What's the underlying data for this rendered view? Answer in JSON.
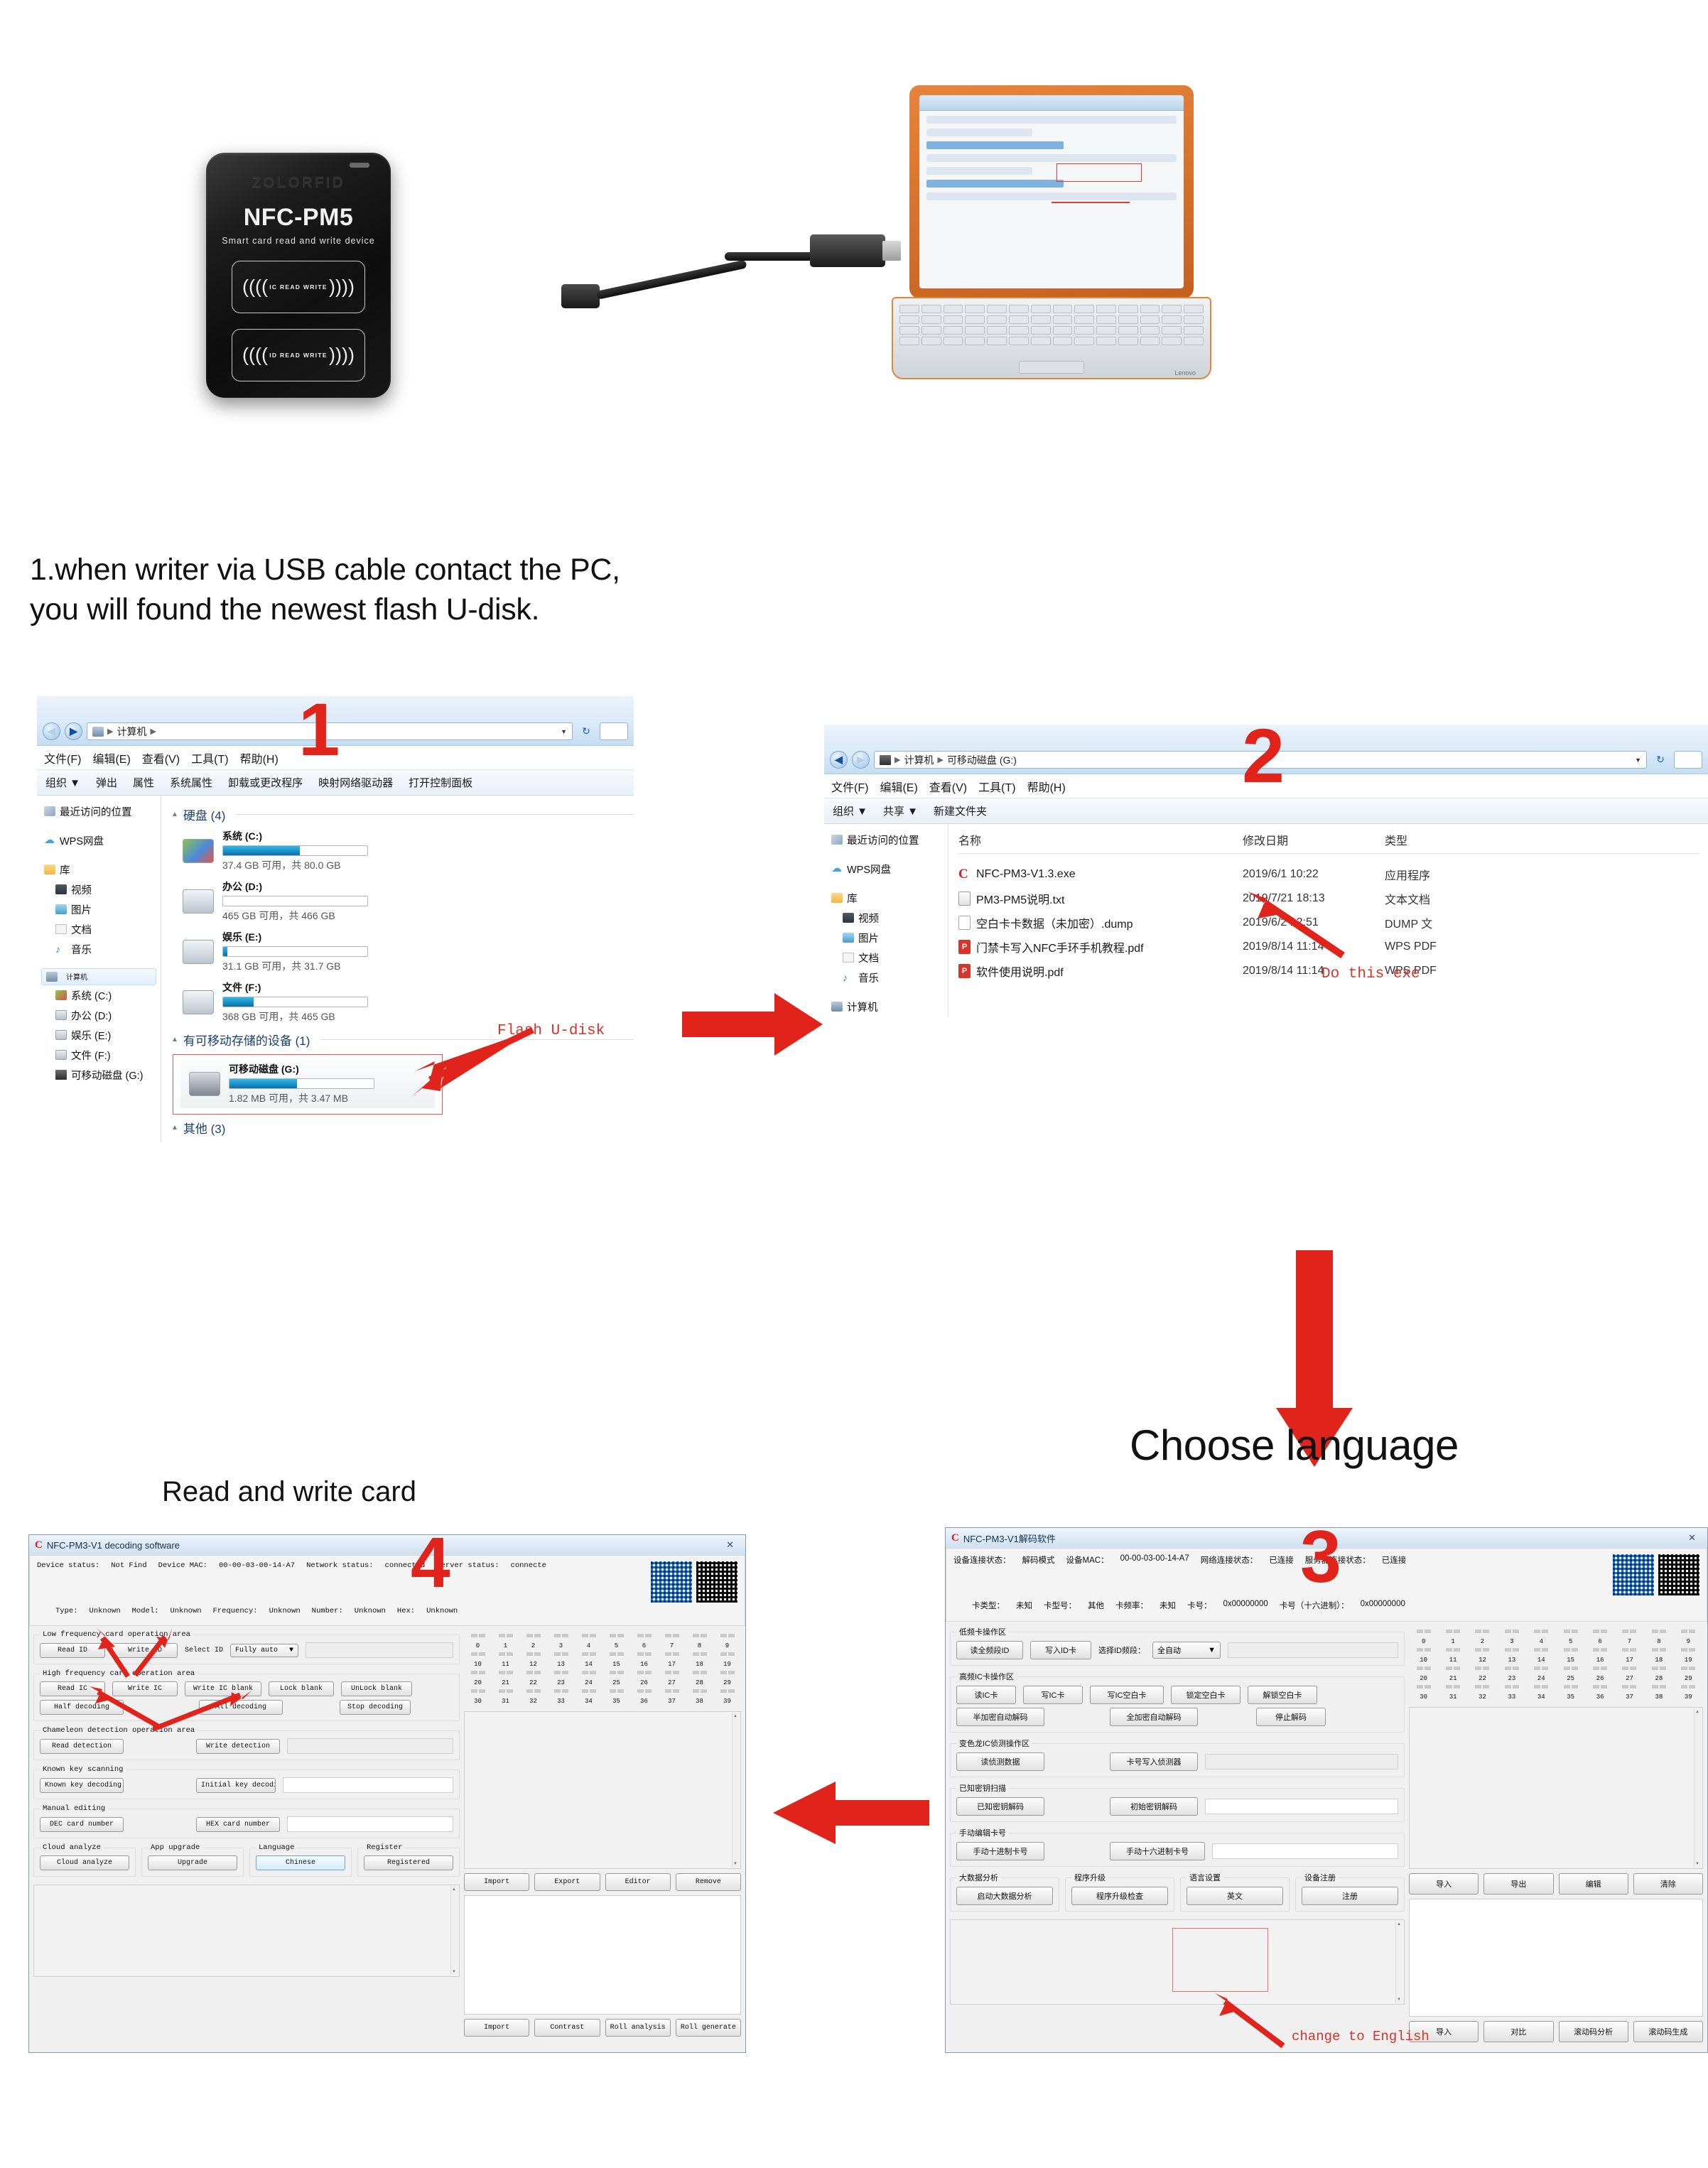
{
  "hero": {
    "device": {
      "brand": "ZOLORFID",
      "model": "NFC-PM5",
      "subtitle": "Smart  card  read  and  write  device",
      "pad_ic_label": "IC READ WRITE",
      "pad_id_label": "ID READ WRITE"
    },
    "laptop_brand": "Lenovo"
  },
  "caption": {
    "line1": "1.when writer via USB cable contact the PC,",
    "line2": "you will found the newest flash U-disk."
  },
  "headings": {
    "choose_language": "Choose language",
    "read_and_write_card": "Read and write card"
  },
  "steps": {
    "one": "1",
    "two": "2",
    "three": "3",
    "four": "4"
  },
  "annotations": {
    "flash_udisk": "Flash U-disk",
    "do_this_exe": "Do this exe",
    "change_to_english": "change to English"
  },
  "explorer1": {
    "breadcrumb": [
      "计算机"
    ],
    "menu": [
      "文件(F)",
      "编辑(E)",
      "查看(V)",
      "工具(T)",
      "帮助(H)"
    ],
    "toolbar": [
      "组织 ▼",
      "弹出",
      "属性",
      "系统属性",
      "卸载或更改程序",
      "映射网络驱动器",
      "打开控制面板"
    ],
    "nav": [
      {
        "label": "最近访问的位置",
        "icon": "recent-places-icon",
        "indent": false
      },
      {
        "label": "WPS网盘",
        "icon": "cloud-icon",
        "indent": false
      },
      {
        "label": "库",
        "icon": "folder-icon",
        "indent": false
      },
      {
        "label": "视频",
        "icon": "video-icon",
        "indent": true
      },
      {
        "label": "图片",
        "icon": "picture-icon",
        "indent": true
      },
      {
        "label": "文档",
        "icon": "document-icon",
        "indent": true
      },
      {
        "label": "音乐",
        "icon": "music-icon",
        "indent": true
      },
      {
        "label": "计算机",
        "icon": "computer-icon",
        "indent": false,
        "selected": true
      },
      {
        "label": "系统 (C:)",
        "icon": "system-drive-icon",
        "indent": true
      },
      {
        "label": "办公 (D:)",
        "icon": "drive-icon",
        "indent": true
      },
      {
        "label": "娱乐 (E:)",
        "icon": "drive-icon",
        "indent": true
      },
      {
        "label": "文件 (F:)",
        "icon": "drive-icon",
        "indent": true
      },
      {
        "label": "可移动磁盘 (G:)",
        "icon": "usb-drive-icon",
        "indent": true
      }
    ],
    "group_hdd": "硬盘 (4)",
    "group_removable": "有可移动存储的设备 (1)",
    "group_other": "其他 (3)",
    "drives": [
      {
        "name": "系统 (C:)",
        "free": "37.4 GB 可用，共 80.0 GB",
        "fill": 53,
        "icon": "system-drive-icon"
      },
      {
        "name": "办公 (D:)",
        "free": "465 GB 可用，共 466 GB",
        "fill": 0,
        "icon": "drive-icon"
      },
      {
        "name": "娱乐 (E:)",
        "free": "31.1 GB 可用，共 31.7 GB",
        "fill": 3,
        "icon": "drive-icon"
      },
      {
        "name": "文件 (F:)",
        "free": "368 GB 可用，共 465 GB",
        "fill": 21,
        "icon": "drive-icon"
      }
    ],
    "removable": {
      "name": "可移动磁盘 (G:)",
      "free": "1.82 MB 可用，共 3.47 MB",
      "fill": 47,
      "icon": "usb-drive-icon"
    }
  },
  "explorer2": {
    "breadcrumb": [
      "计算机",
      "可移动磁盘 (G:)"
    ],
    "menu": [
      "文件(F)",
      "编辑(E)",
      "查看(V)",
      "工具(T)",
      "帮助(H)"
    ],
    "toolbar": [
      "组织 ▼",
      "共享 ▼",
      "新建文件夹"
    ],
    "nav": [
      {
        "label": "最近访问的位置",
        "icon": "recent-places-icon",
        "indent": false
      },
      {
        "label": "WPS网盘",
        "icon": "cloud-icon",
        "indent": false
      },
      {
        "label": "库",
        "icon": "folder-icon",
        "indent": false
      },
      {
        "label": "视频",
        "icon": "video-icon",
        "indent": true
      },
      {
        "label": "图片",
        "icon": "picture-icon",
        "indent": true
      },
      {
        "label": "文档",
        "icon": "document-icon",
        "indent": true
      },
      {
        "label": "音乐",
        "icon": "music-icon",
        "indent": true
      },
      {
        "label": "计算机",
        "icon": "computer-icon",
        "indent": false
      }
    ],
    "columns": [
      "名称",
      "修改日期",
      "类型"
    ],
    "files": [
      {
        "name": "NFC-PM3-V1.3.exe",
        "date": "2019/6/1 10:22",
        "type": "应用程序",
        "icon": "exe-icon"
      },
      {
        "name": "PM3-PM5说明.txt",
        "date": "2019/7/21 18:13",
        "type": "文本文档",
        "icon": "txt-icon"
      },
      {
        "name": "空白卡卡数据（未加密）.dump",
        "date": "2019/6/2 12:51",
        "type": "DUMP 文",
        "icon": "dump-icon"
      },
      {
        "name": "门禁卡写入NFC手环手机教程.pdf",
        "date": "2019/8/14 11:14",
        "type": "WPS PDF",
        "icon": "pdf-icon"
      },
      {
        "name": "软件使用说明.pdf",
        "date": "2019/8/14 11:14",
        "type": "WPS PDF",
        "icon": "pdf-icon"
      }
    ]
  },
  "app_en": {
    "title": "NFC-PM3-V1 decoding software",
    "status": {
      "device_status_label": "Device status:",
      "device_status_value": "Not Find",
      "device_mac_label": "Device MAC:",
      "device_mac_value": "00-00-03-00-14-A7",
      "network_label": "Network status:",
      "network_value": "connected",
      "server_label": "Server status:",
      "server_value": "connecte",
      "type_label": "Type:",
      "type_value": "Unknown",
      "model_label": "Model:",
      "model_value": "Unknown",
      "frequency_label": "Frequency:",
      "frequency_value": "Unknown",
      "number_label": "Number:",
      "number_value": "Unknown",
      "hex_label": "Hex:",
      "hex_value": "Unknown"
    },
    "groups": {
      "low_freq": "Low frequency card operation area",
      "high_freq": "High frequency card operation area",
      "chameleon": "Chameleon detection operation area",
      "known_key": "Known key scanning",
      "manual_edit": "Manual editing",
      "cloud": "Cloud analyze",
      "app_upgrade": "App upgrade",
      "language": "Language",
      "register": "Register"
    },
    "buttons": {
      "read_id": "Read ID",
      "write_id": "Write ID",
      "select_id_label": "Select ID",
      "select_id_value": "Fully auto",
      "read_ic": "Read IC",
      "write_ic": "Write IC",
      "write_ic_blank": "Write IC blank",
      "lock_blank": "Lock blank",
      "unlock_blank": "UnLock blank",
      "half_decoding": "Half decoding",
      "all_decoding": "All decoding",
      "stop_decoding": "Stop decoding",
      "read_detection": "Read detection",
      "write_detection": "Write detection",
      "known_key_decoding": "Known key decoding",
      "initial_key_decoding": "Initial key decoding",
      "dec_card_number": "DEC card number",
      "hex_card_number": "HEX card number",
      "cloud_analyze": "Cloud analyze",
      "upgrade": "Upgrade",
      "chinese": "Chinese",
      "registered": "Registered",
      "import": "Import",
      "export": "Export",
      "editor": "Editor",
      "remove": "Remove",
      "import2": "Import",
      "contrast": "Contrast",
      "roll_analysis": "Roll analysis",
      "roll_generate": "Roll generate"
    },
    "hex_labels": [
      "0",
      "1",
      "2",
      "3",
      "4",
      "5",
      "6",
      "7",
      "8",
      "9",
      "10",
      "11",
      "12",
      "13",
      "14",
      "15",
      "16",
      "17",
      "18",
      "19",
      "20",
      "21",
      "22",
      "23",
      "24",
      "25",
      "26",
      "27",
      "28",
      "29",
      "30",
      "31",
      "32",
      "33",
      "34",
      "35",
      "36",
      "37",
      "38",
      "39"
    ]
  },
  "app_cn": {
    "title": "NFC-PM3-V1解码软件",
    "status": {
      "device_status_label": "设备连接状态：",
      "device_status_value": "解码模式",
      "device_mac_label": "设备MAC：",
      "device_mac_value": "00-00-03-00-14-A7",
      "network_label": "网络连接状态：",
      "network_value": "已连接",
      "server_label": "服务器连接状态：",
      "server_value": "已连接",
      "card_type_label": "卡类型：",
      "card_type_value": "未知",
      "card_model_label": "卡型号：",
      "card_model_value": "其他",
      "card_freq_label": "卡频率：",
      "card_freq_value": "未知",
      "card_no_label": "卡号：",
      "card_no_value": "0x00000000",
      "card_hex_label": "卡号（十六进制）：",
      "card_hex_value": "0x00000000"
    },
    "groups": {
      "low_freq": "低频卡操作区",
      "high_freq": "高频IC卡操作区",
      "chameleon": "变色龙IC侦测操作区",
      "known_key": "已知密钥扫描",
      "manual_edit": "手动编辑卡号",
      "bigdata": "大数据分析",
      "upgrade": "程序升级",
      "language": "语言设置",
      "register": "设备注册"
    },
    "buttons": {
      "read_id": "读全频段ID",
      "write_id": "写入ID卡",
      "select_id_label": "选择ID频段：",
      "select_id_value": "全自动",
      "read_ic": "读IC卡",
      "write_ic": "写IC卡",
      "write_ic_blank": "写IC空白卡",
      "lock_blank": "锁定空白卡",
      "unlock_blank": "解锁空白卡",
      "half_decoding": "半加密自动解码",
      "all_decoding": "全加密自动解码",
      "stop_decoding": "停止解码",
      "read_detection": "读侦测数据",
      "write_detection": "卡号写入侦测器",
      "known_key_decoding": "已知密钥解码",
      "initial_key_decoding": "初始密钥解码",
      "dec_card_number": "手动十进制卡号",
      "hex_card_number": "手动十六进制卡号",
      "bigdata_start": "启动大数据分析",
      "upgrade_check": "程序升级检查",
      "english": "英文",
      "register": "注册",
      "import": "导入",
      "export": "导出",
      "edit": "编辑",
      "clear": "清除",
      "import2": "导入",
      "contrast": "对比",
      "roll_analysis": "滚动码分析",
      "roll_generate": "滚动码生成"
    },
    "hex_labels": [
      "0",
      "1",
      "2",
      "3",
      "4",
      "5",
      "6",
      "7",
      "8",
      "9",
      "10",
      "11",
      "12",
      "13",
      "14",
      "15",
      "16",
      "17",
      "18",
      "19",
      "20",
      "21",
      "22",
      "23",
      "24",
      "25",
      "26",
      "27",
      "28",
      "29",
      "30",
      "31",
      "32",
      "33",
      "34",
      "35",
      "36",
      "37",
      "38",
      "39"
    ]
  },
  "colors": {
    "accent_red": "#e0231b",
    "annotation_red": "#d6342b",
    "highlight_box": "#ef6f66"
  }
}
